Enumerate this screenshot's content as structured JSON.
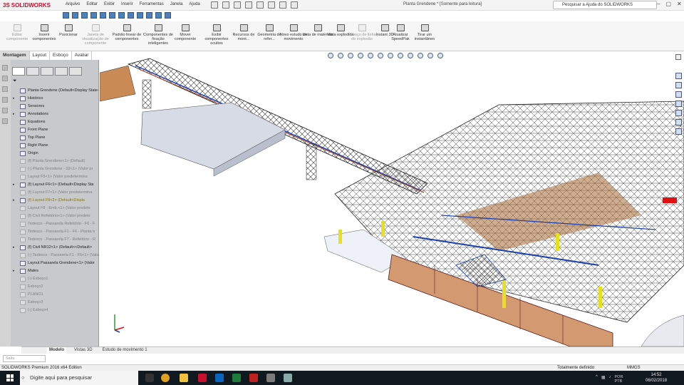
{
  "app": {
    "brand": "SOLIDWORKS",
    "doc_title": "Planta Grendene * [Somente para leitura]"
  },
  "menus": [
    "Arquivo",
    "Editar",
    "Exibir",
    "Inserir",
    "Ferramentas",
    "Janela",
    "Ajuda"
  ],
  "help_search": {
    "placeholder": "Pesquisar a Ajuda do SOLIDWORKS"
  },
  "ribbon": [
    {
      "label": "Editar componente",
      "enabled": false
    },
    {
      "label": "Inserir componentes",
      "enabled": true
    },
    {
      "label": "Posicionar",
      "enabled": true
    },
    {
      "label": "Janela de visualização de componente",
      "enabled": false
    },
    {
      "label": "Padrão linear de componentes",
      "enabled": true
    },
    {
      "label": "Componentes de fixação inteligentes",
      "enabled": true
    },
    {
      "label": "Mover componente",
      "enabled": true
    },
    {
      "label": "Exibir componentes ocultos",
      "enabled": true
    },
    {
      "label": "Recursos de mont...",
      "enabled": true
    },
    {
      "label": "Geometria de refer...",
      "enabled": true
    },
    {
      "label": "Novo estudo de movimento",
      "enabled": true
    },
    {
      "label": "Lista de materiais",
      "enabled": true
    },
    {
      "label": "Vista explodida",
      "enabled": true
    },
    {
      "label": "Esboço de linha de explosão",
      "enabled": false
    },
    {
      "label": "Instant 3D",
      "enabled": true
    },
    {
      "label": "Atualizar SpeedPak",
      "enabled": true
    },
    {
      "label": "Tirar um instantâneo",
      "enabled": true
    }
  ],
  "cmd_tabs": [
    "Montagem",
    "Layout",
    "Esboço",
    "Avaliar"
  ],
  "tree": [
    {
      "label": "Planta Grendene  (Default<Display State-1>)",
      "state": "normal",
      "exp": ""
    },
    {
      "label": "Histórico",
      "state": "normal",
      "exp": "▸"
    },
    {
      "label": "Sensores",
      "state": "normal",
      "exp": ""
    },
    {
      "label": "Annotations",
      "state": "normal",
      "exp": "▸"
    },
    {
      "label": "Equations",
      "state": "normal",
      "exp": ""
    },
    {
      "label": "Front Plane",
      "state": "normal",
      "exp": ""
    },
    {
      "label": "Top Plane",
      "state": "normal",
      "exp": ""
    },
    {
      "label": "Right Plane",
      "state": "normal",
      "exp": ""
    },
    {
      "label": "Origin",
      "state": "normal",
      "exp": ""
    },
    {
      "label": "(f) Planta Grendene<1> (Default)",
      "state": "gray",
      "exp": ""
    },
    {
      "label": "(-) Planta Grendene - 02<1> (Valor pr",
      "state": "gray",
      "exp": ""
    },
    {
      "label": "Layout F5<1> (Valor predetermina",
      "state": "gray",
      "exp": ""
    },
    {
      "label": "(f) Layout F6<1> (Default<Display Sta",
      "state": "normal",
      "exp": "▸"
    },
    {
      "label": "(f) Layout F7<1> (Valor predetermina",
      "state": "gray",
      "exp": ""
    },
    {
      "label": "(f) Layout F8<2> (Default<Displa",
      "state": "warn",
      "exp": "▸"
    },
    {
      "label": "Layout F8 - Emb.<1> (Valor predete",
      "state": "gray",
      "exp": ""
    },
    {
      "label": "(f) Civil Refeitório<1> (Valor predete",
      "state": "gray",
      "exp": ""
    },
    {
      "label": "Tedesco - Passarela Refeitório - F6 - F",
      "state": "gray",
      "exp": ""
    },
    {
      "label": "Tedesco - Passarela F1 - F6 - Planta b",
      "state": "gray",
      "exp": ""
    },
    {
      "label": "Tedesco - Passarela F7 - Refeitório - R",
      "state": "gray",
      "exp": ""
    },
    {
      "label": "(f) Civil NR12<1> (Default<<Default>",
      "state": "normal",
      "exp": "▸"
    },
    {
      "label": "(-) Tedesco - Passarela F1 - F6<1> (Valo",
      "state": "gray",
      "exp": ""
    },
    {
      "label": "Layout Passarela Grendene<1> (Valor",
      "state": "normal",
      "exp": ""
    },
    {
      "label": "Mates",
      "state": "normal",
      "exp": "▸"
    },
    {
      "label": "(-) Esboço1",
      "state": "gray",
      "exp": ""
    },
    {
      "label": "Esboço2",
      "state": "gray",
      "exp": ""
    },
    {
      "label": "PLANO1",
      "state": "gray",
      "exp": ""
    },
    {
      "label": "Esboço3",
      "state": "gray",
      "exp": ""
    },
    {
      "label": "(-) Esboço4",
      "state": "gray",
      "exp": ""
    }
  ],
  "bottom_tabs": [
    "Modelo",
    "Vistas 3D",
    "Estudo de movimento 1"
  ],
  "search_small": "Salto",
  "status": {
    "left": "SOLIDWORKS Premium 2016 x64 Edition",
    "mid": "Totalmente definido",
    "units": "MMGS"
  },
  "taskbar": {
    "search": "Digite aqui para pesquisar",
    "lang": "POR",
    "kbd": "PTB",
    "time": "14:52",
    "date": "06/02/2018"
  }
}
